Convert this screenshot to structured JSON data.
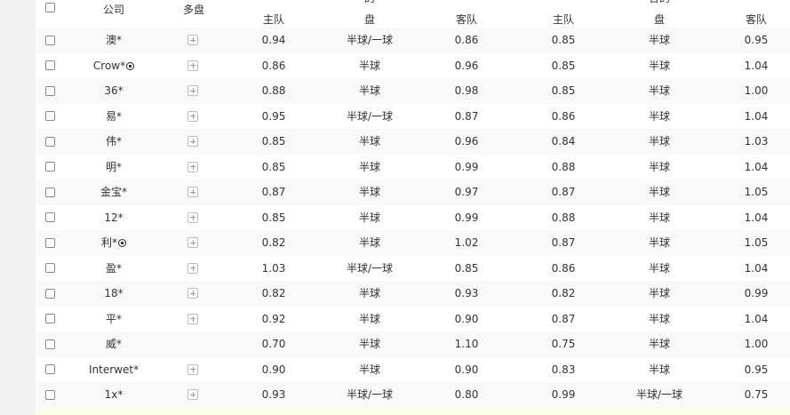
{
  "header": {
    "company": "公司",
    "multi": "多盘",
    "group1_partial": "的",
    "group2_partial": "合的",
    "home1": "主队",
    "line1": "盘",
    "away1": "客队",
    "home2": "主队",
    "line2": "盘",
    "away2": "客队"
  },
  "icons": {
    "plus": "plus-icon",
    "ball": "soccer-ball-icon"
  },
  "rows": [
    {
      "company": "澳*",
      "ball": false,
      "plus": true,
      "h1": "0.94",
      "l1": "半球/一球",
      "a1": "0.86",
      "h2": "0.85",
      "l2": "半球",
      "a2": "0.95"
    },
    {
      "company": "Crow*",
      "ball": true,
      "plus": true,
      "h1": "0.86",
      "l1": "半球",
      "a1": "0.96",
      "h2": "0.85",
      "l2": "半球",
      "a2": "1.04"
    },
    {
      "company": "36*",
      "ball": false,
      "plus": true,
      "h1": "0.88",
      "l1": "半球",
      "a1": "0.98",
      "h2": "0.85",
      "l2": "半球",
      "a2": "1.00"
    },
    {
      "company": "易*",
      "ball": false,
      "plus": true,
      "h1": "0.95",
      "l1": "半球/一球",
      "a1": "0.87",
      "h2": "0.86",
      "l2": "半球",
      "a2": "1.04"
    },
    {
      "company": "伟*",
      "ball": false,
      "plus": true,
      "h1": "0.85",
      "l1": "半球",
      "a1": "0.96",
      "h2": "0.84",
      "l2": "半球",
      "a2": "1.03"
    },
    {
      "company": "明*",
      "ball": false,
      "plus": true,
      "h1": "0.85",
      "l1": "半球",
      "a1": "0.99",
      "h2": "0.88",
      "l2": "半球",
      "a2": "1.04"
    },
    {
      "company": "金宝*",
      "ball": false,
      "plus": true,
      "h1": "0.87",
      "l1": "半球",
      "a1": "0.97",
      "h2": "0.87",
      "l2": "半球",
      "a2": "1.05"
    },
    {
      "company": "12*",
      "ball": false,
      "plus": true,
      "h1": "0.85",
      "l1": "半球",
      "a1": "0.99",
      "h2": "0.88",
      "l2": "半球",
      "a2": "1.04"
    },
    {
      "company": "利*",
      "ball": true,
      "plus": true,
      "h1": "0.82",
      "l1": "半球",
      "a1": "1.02",
      "h2": "0.87",
      "l2": "半球",
      "a2": "1.05"
    },
    {
      "company": "盈*",
      "ball": false,
      "plus": true,
      "h1": "1.03",
      "l1": "半球/一球",
      "a1": "0.85",
      "h2": "0.86",
      "l2": "半球",
      "a2": "1.04"
    },
    {
      "company": "18*",
      "ball": false,
      "plus": true,
      "h1": "0.82",
      "l1": "半球",
      "a1": "0.93",
      "h2": "0.82",
      "l2": "半球",
      "a2": "0.99"
    },
    {
      "company": "平*",
      "ball": false,
      "plus": true,
      "h1": "0.92",
      "l1": "半球",
      "a1": "0.90",
      "h2": "0.87",
      "l2": "半球",
      "a2": "1.04"
    },
    {
      "company": "威*",
      "ball": false,
      "plus": false,
      "h1": "0.70",
      "l1": "半球",
      "a1": "1.10",
      "h2": "0.75",
      "l2": "半球",
      "a2": "1.00"
    },
    {
      "company": "Interwet*",
      "ball": false,
      "plus": true,
      "h1": "0.90",
      "l1": "半球",
      "a1": "0.90",
      "h2": "0.83",
      "l2": "半球",
      "a2": "0.95"
    },
    {
      "company": "1x*",
      "ball": false,
      "plus": true,
      "h1": "0.93",
      "l1": "半球/一球",
      "a1": "0.80",
      "h2": "0.99",
      "l2": "半球/一球",
      "a2": "0.75"
    }
  ]
}
